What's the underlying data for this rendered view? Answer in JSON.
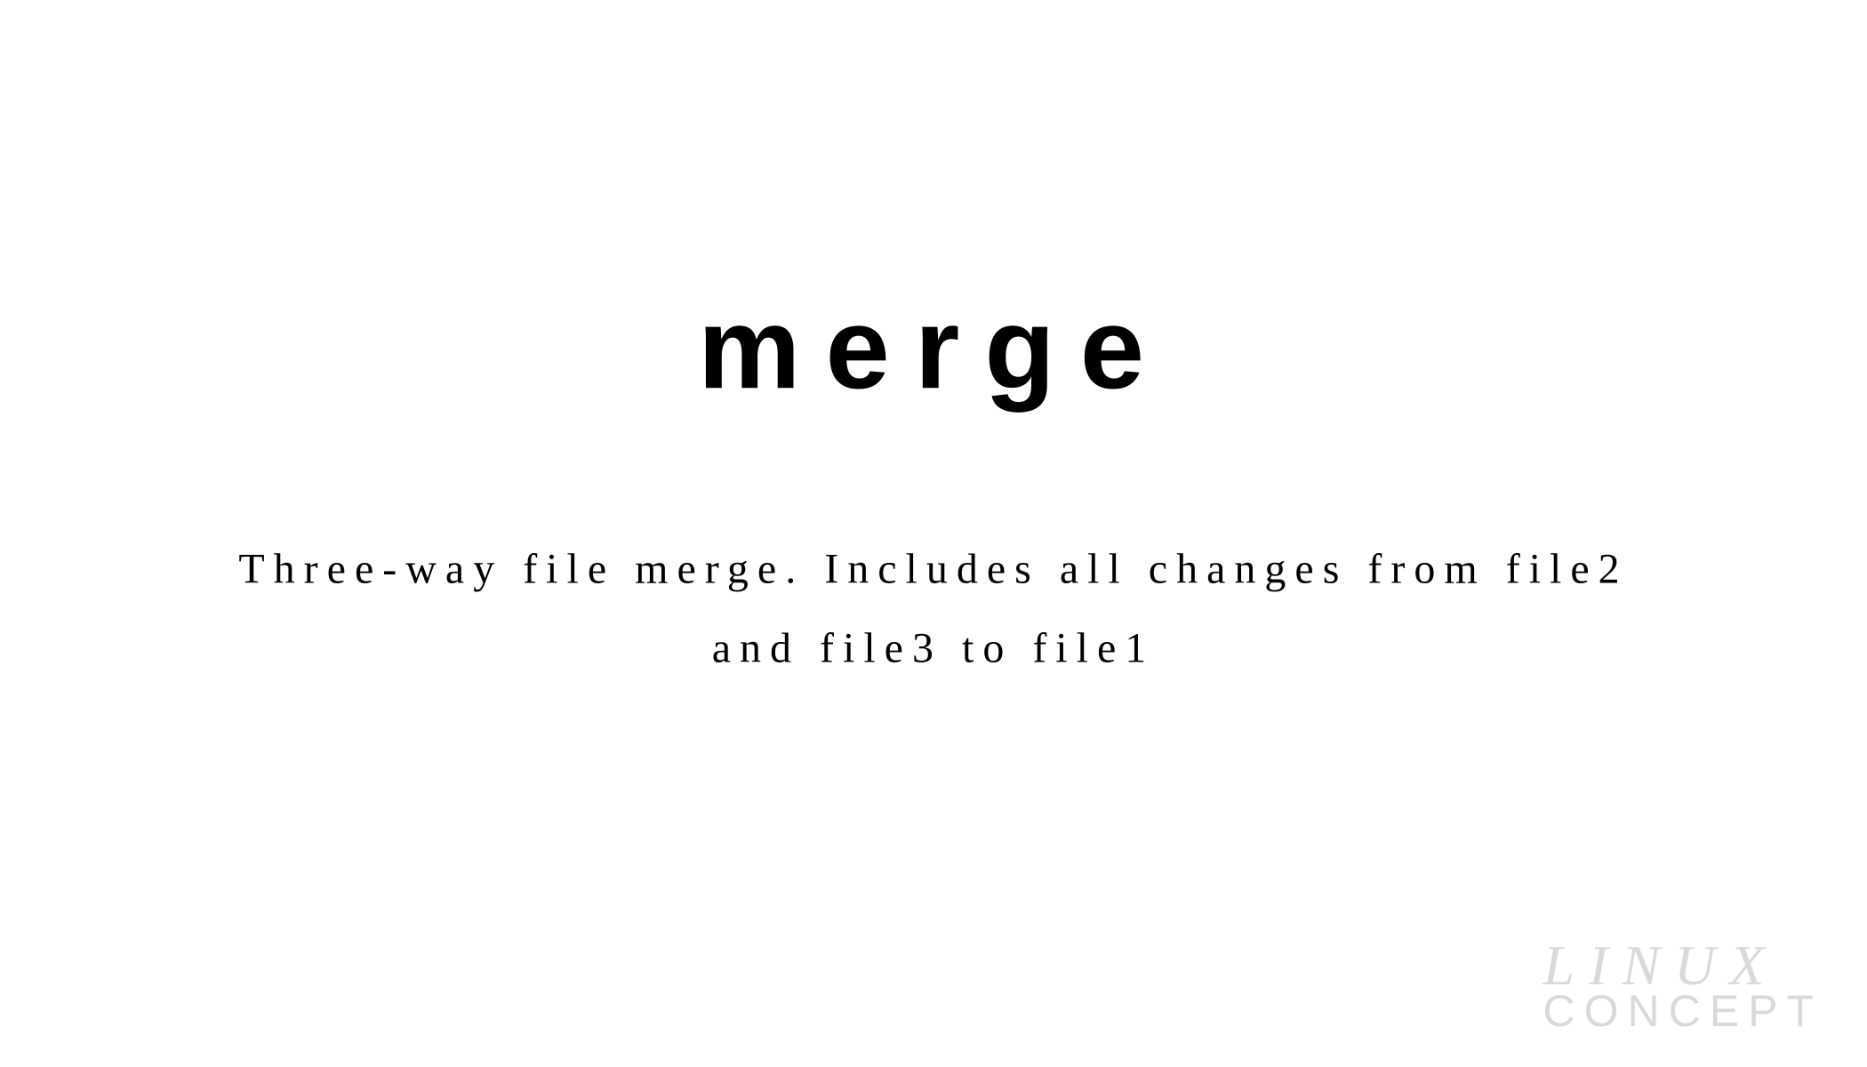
{
  "title": "merge",
  "description": "Three-way file merge. Includes all changes from file2 and file3 to file1",
  "watermark": {
    "line1": "LINUX",
    "line2": "CONCEPT"
  }
}
